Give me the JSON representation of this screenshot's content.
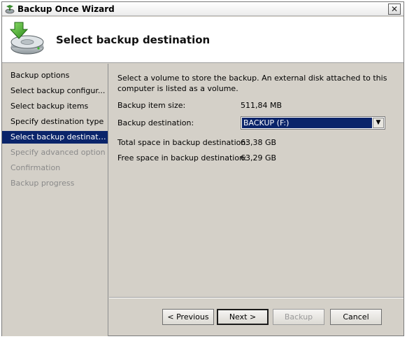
{
  "window": {
    "title": "Backup Once Wizard",
    "close_glyph": "✕"
  },
  "header": {
    "title": "Select backup destination",
    "icon": "backup-disk-icon"
  },
  "steps": [
    {
      "label": "Backup options",
      "state": "done"
    },
    {
      "label": "Select backup configur...",
      "state": "done"
    },
    {
      "label": "Select backup items",
      "state": "done"
    },
    {
      "label": "Specify destination type",
      "state": "done"
    },
    {
      "label": "Select backup destination",
      "state": "active"
    },
    {
      "label": "Specify advanced option",
      "state": "disabled"
    },
    {
      "label": "Confirmation",
      "state": "disabled"
    },
    {
      "label": "Backup progress",
      "state": "disabled"
    }
  ],
  "content": {
    "description": "Select a volume to store the backup. An external disk attached to this computer is listed as a volume.",
    "item_size_label": "Backup item size:",
    "item_size_value": "511,84 MB",
    "destination_label": "Backup destination:",
    "destination_value": "BACKUP (F:)",
    "total_space_label": "Total space in backup destination:",
    "total_space_value": "63,38 GB",
    "free_space_label": "Free space in backup destination:",
    "free_space_value": "63,29 GB"
  },
  "buttons": {
    "previous": "< Previous",
    "next": "Next >",
    "backup": "Backup",
    "cancel": "Cancel"
  },
  "colors": {
    "selection": "#0a246a",
    "dialog_bg": "#d4d0c8"
  }
}
